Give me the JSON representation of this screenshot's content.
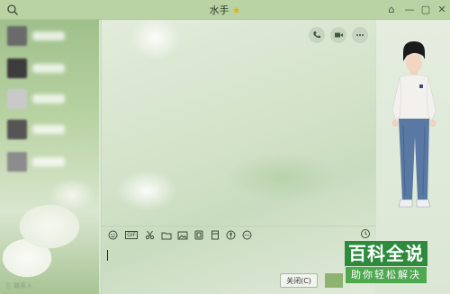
{
  "window": {
    "title": "水手",
    "title_star": "★",
    "controls": {
      "skin": "⌂",
      "minimize": "—",
      "maximize": "▢",
      "close": "✕"
    }
  },
  "sidebar": {
    "contacts": [
      {
        "avatar_color": "#6a6a6a"
      },
      {
        "avatar_color": "#3c3c3c"
      },
      {
        "avatar_color": "#c9c9c9"
      },
      {
        "avatar_color": "#555555"
      },
      {
        "avatar_color": "#8c8c8c"
      }
    ],
    "bottom_text": "三 联系人"
  },
  "chat": {
    "top_icons": [
      "phone-icon",
      "video-icon",
      "more-icon"
    ],
    "toolbar_icons": [
      "emoji-icon",
      "gif-icon",
      "scissors-icon",
      "folder-icon",
      "image-icon",
      "screen-share-icon",
      "red-packet-icon",
      "voice-icon",
      "more-tools-icon"
    ],
    "gif_label": "GIF",
    "close_label": "关闭(C)",
    "input_value": ""
  },
  "watermark": {
    "main": "百科全说",
    "sub": "助你轻松解决"
  },
  "colors": {
    "accent_green": "#2e8b3e",
    "title_bar": "#b9d3a4"
  }
}
